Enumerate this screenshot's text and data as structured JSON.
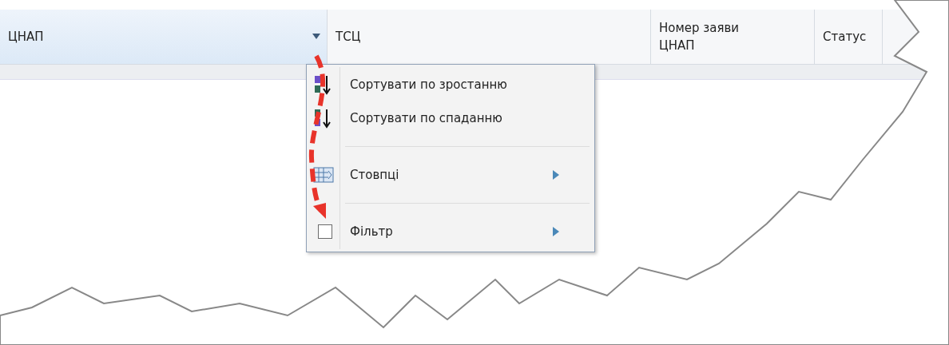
{
  "table": {
    "columns": [
      {
        "label": "ЦНАП",
        "selected": true
      },
      {
        "label": "ТСЦ",
        "selected": false
      },
      {
        "label": "Номер заяви ЦНАП",
        "selected": false
      },
      {
        "label": "Статус",
        "selected": false
      }
    ]
  },
  "column_menu": {
    "groups": [
      [
        {
          "kind": "sort-asc",
          "label": "Сортувати по зростанню",
          "submenu": false
        },
        {
          "kind": "sort-desc",
          "label": "Сортувати по спаданню",
          "submenu": false
        }
      ],
      [
        {
          "kind": "columns",
          "label": "Стовпці",
          "submenu": true
        }
      ],
      [
        {
          "kind": "filter",
          "label": "Фільтр",
          "submenu": true,
          "checked": false
        }
      ]
    ]
  }
}
